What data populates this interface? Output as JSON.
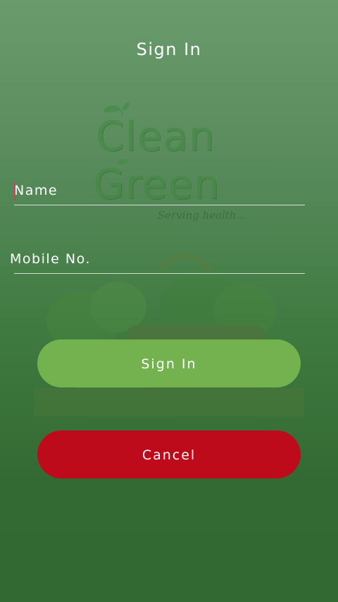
{
  "header": {
    "title": "Sign In"
  },
  "logo": {
    "line1": "Clean",
    "line2": "Green",
    "tagline": "Serving health..."
  },
  "form": {
    "name": {
      "placeholder": "Name",
      "value": ""
    },
    "mobile": {
      "placeholder": "Mobile No.",
      "value": ""
    }
  },
  "actions": {
    "signin_label": "Sign In",
    "cancel_label": "Cancel"
  },
  "colors": {
    "signin_button": "#74b14f",
    "cancel_button": "#be0b1c",
    "cursor": "#d9385a"
  },
  "icons": {
    "logo_leaf": "leaf-icon",
    "background": "vegetable-basket-image"
  }
}
